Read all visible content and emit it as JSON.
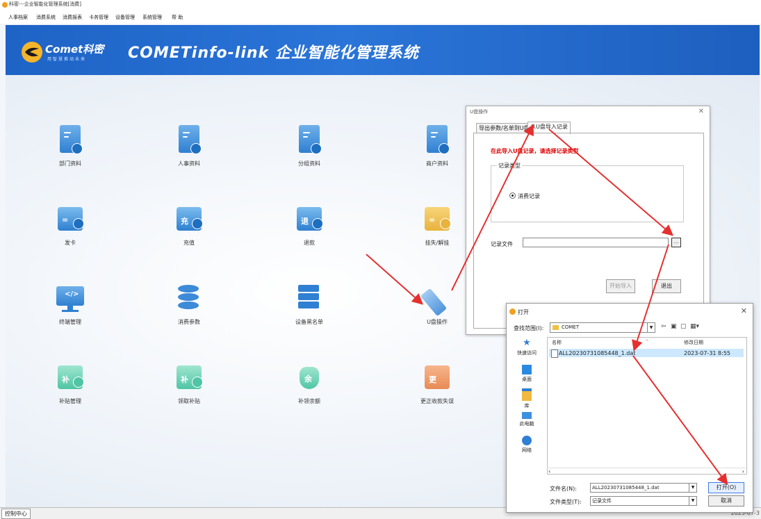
{
  "window": {
    "title": "科密---企业智能化管理系统[消费]",
    "menu": [
      "人事档案",
      "消费系统",
      "消费报表",
      "卡务管理",
      "设备管理",
      "系统管理",
      "帮 助"
    ]
  },
  "banner": {
    "logo_name": "Comet科密",
    "logo_slogan": "用智慧推动未来",
    "system_title": "COMETinfo-link 企业智能化管理系统"
  },
  "tiles": [
    {
      "label": "部门资料",
      "icon": "department-doc-icon"
    },
    {
      "label": "人事资料",
      "icon": "personnel-doc-icon"
    },
    {
      "label": "分组资料",
      "icon": "group-doc-icon"
    },
    {
      "label": "商户资料",
      "icon": "merchant-doc-icon"
    },
    {
      "label": "发卡",
      "icon": "issue-card-icon"
    },
    {
      "label": "充值",
      "icon": "recharge-icon",
      "glyph": "充"
    },
    {
      "label": "退款",
      "icon": "refund-icon",
      "glyph": "退"
    },
    {
      "label": "挂失/解挂",
      "icon": "report-loss-icon"
    },
    {
      "label": "终端管理",
      "icon": "terminal-monitor-icon",
      "glyph": "</>"
    },
    {
      "label": "消费参数",
      "icon": "database-icon"
    },
    {
      "label": "设备黑名单",
      "icon": "server-icon"
    },
    {
      "label": "U盘操作",
      "icon": "usb-drive-icon"
    },
    {
      "label": "补贴管理",
      "icon": "subsidy-icon",
      "glyph": "补"
    },
    {
      "label": "领取补贴",
      "icon": "receive-subsidy-icon",
      "glyph": "补"
    },
    {
      "label": "补领余额",
      "icon": "balance-bag-icon",
      "glyph": "余"
    },
    {
      "label": "更正收款失误",
      "icon": "correction-icon",
      "glyph": "更"
    }
  ],
  "status_bar": {
    "left": "控制中心",
    "right": "2023-07-3"
  },
  "usb_dialog": {
    "title": "U盘操作",
    "tabs": [
      "导出参数/名单到U盘",
      "从U盘导入记录"
    ],
    "active_tab": 1,
    "hint": "在此导入U盘记录，请选择记录类型",
    "group_title": "记录类型",
    "radio_label": "消费记录",
    "file_label": "记录文件",
    "file_value": "",
    "browse_label": "...",
    "start_import": "开始导入",
    "exit": "退出"
  },
  "open_dialog": {
    "title": "打开",
    "look_in_label": "查找范围(I):",
    "look_in_value": "COMET",
    "places": [
      "快速访问",
      "桌面",
      "库",
      "此电脑",
      "网络"
    ],
    "columns": {
      "name": "名称",
      "modified": "修改日期"
    },
    "files": [
      {
        "name": "ALL20230731085448_1.dat",
        "modified": "2023-07-31 8:55"
      }
    ],
    "filename_label": "文件名(N):",
    "filename_value": "ALL20230731085448_1.dat",
    "filetype_label": "文件类型(T):",
    "filetype_value": "记录文件",
    "open_button": "打开(O)",
    "cancel_button": "取消"
  },
  "colors": {
    "banner_blue": "#1e63c6",
    "accent_yellow": "#f5b52a",
    "annotation_red": "#e53030",
    "hint_red": "#dd0000"
  }
}
